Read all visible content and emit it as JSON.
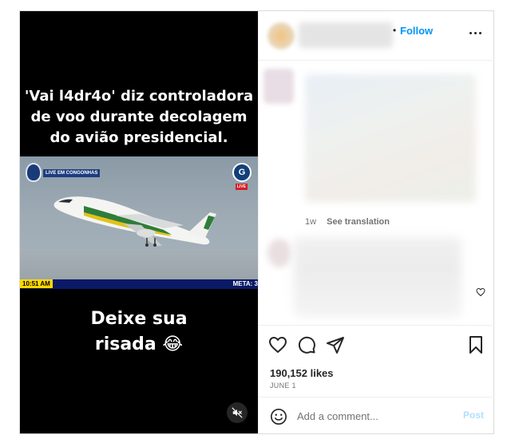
{
  "media": {
    "headline_lines": [
      "'Vai l4dr4o' diz controladora",
      "de voo durante decolagem",
      "do avião presidencial."
    ],
    "video": {
      "live_chip": "LIVE EM CONGONHAS",
      "live_badge": "LIVE",
      "time": "10:51 AM",
      "meta": "META: 3"
    },
    "caption_lines": [
      "Deixe sua",
      "risada 😂"
    ],
    "mute_icon": "speaker-muted-icon"
  },
  "header": {
    "separator": "•",
    "follow_label": "Follow",
    "more_icon": "more-horizontal-icon"
  },
  "caption": {
    "age": "1w",
    "translate_label": "See translation"
  },
  "actions": {
    "like_icon": "heart-icon",
    "comment_icon": "comment-bubble-icon",
    "share_icon": "paper-plane-icon",
    "save_icon": "bookmark-icon",
    "likes_text": "190,152 likes",
    "date_text": "JUNE 1"
  },
  "comment_bar": {
    "emoji_icon": "smiley-icon",
    "placeholder": "Add a comment...",
    "post_label": "Post",
    "post_color": "#b2dffc"
  },
  "colors": {
    "accent": "#0095f6",
    "ticker_blue": "#0a1a66",
    "ticker_yellow": "#ffd800",
    "live_red": "#d21f26"
  }
}
